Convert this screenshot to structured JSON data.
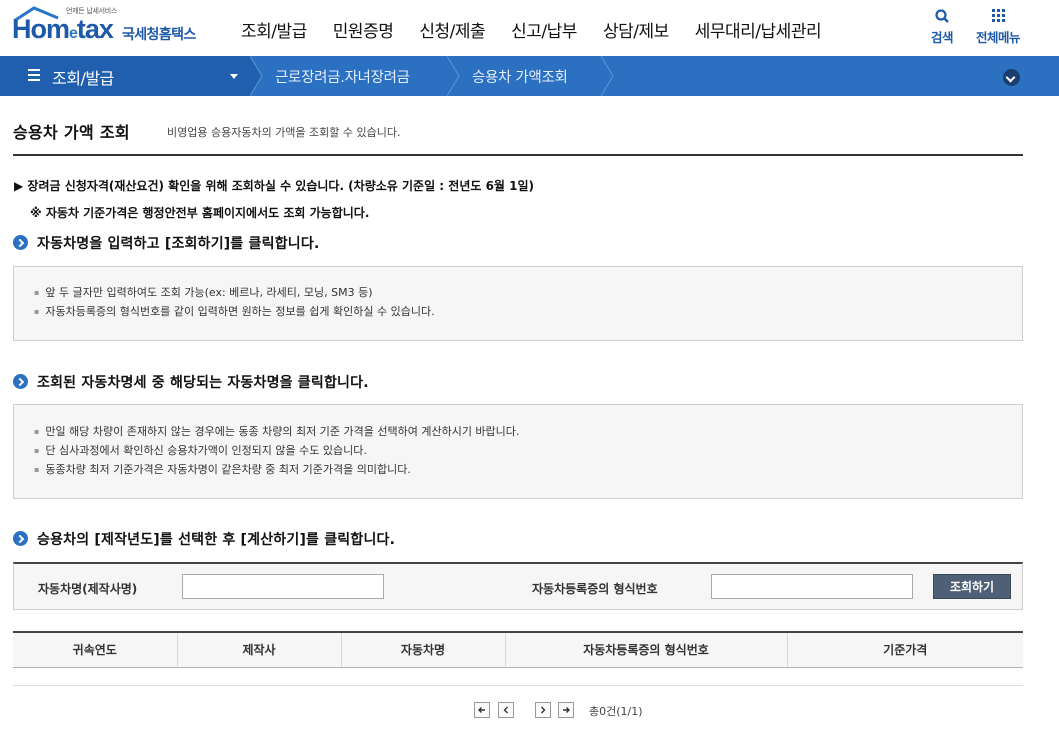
{
  "header": {
    "logo_small": "언제든 납세서비스",
    "logo_home": "Hom",
    "logo_e": "e",
    "logo_tax": "tax",
    "logo_kor": "국세청홈택스",
    "menu": [
      "조회/발급",
      "민원증명",
      "신청/제출",
      "신고/납부",
      "상담/제보",
      "세무대리/납세관리"
    ],
    "search_label": "검색",
    "all_menu_label": "전체메뉴"
  },
  "navbar": {
    "first": "조회/발급",
    "crumbs": [
      "근로장려금.자녀장려금",
      "승용차 가액조회"
    ]
  },
  "page": {
    "title": "승용차 가액 조회",
    "description": "비영업용 승용자동차의 가액을 조회할 수 있습니다.",
    "notice1": "▶ 장려금 신청자격(재산요건) 확인을 위해 조회하실 수 있습니다. (차량소유 기준일 : 전년도 6월 1일)",
    "notice2": "※ 자동차 기준가격은 행정안전부 홈페이지에서도 조회 가능합니다."
  },
  "steps": [
    {
      "title": "자동차명을 입력하고 [조회하기]를 클릭합니다.",
      "items": [
        "앞 두 글자만 입력하여도 조회 가능(ex: 베르나, 라세티, 모닝, SM3 등)",
        "자동차등록증의 형식번호를 같이 입력하면 원하는 정보를 쉽게 확인하실 수 있습니다."
      ]
    },
    {
      "title": "조회된 자동차명세 중 해당되는 자동차명을 클릭합니다.",
      "items": [
        "만일 해당 차량이 존재하지 않는 경우에는 동종 차량의 최저 기준 가격을 선택하여 계산하시기 바랍니다.",
        "단 심사과정에서 확인하신 승용차가액이 인정되지 않을 수도 있습니다.",
        "동종차량 최저 기준가격은 자동차명이 같은차량 중  최저 기준가격을 의미합니다."
      ]
    },
    {
      "title": "승용차의 [제작년도]를 선택한 후 [계산하기]를 클릭합니다."
    }
  ],
  "search": {
    "car_name_label": "자동차명(제작사명)",
    "car_name_value": "",
    "model_no_label": "자동차등록증의 형식번호",
    "model_no_value": "",
    "button_label": "조회하기"
  },
  "table": {
    "columns": [
      "귀속연도",
      "제작사",
      "자동차명",
      "자동차등록증의 형식번호",
      "기준가격"
    ],
    "rows": []
  },
  "paging": {
    "count_text": "총0건(1/1)"
  },
  "colors": {
    "brand_blue": "#2c70c2",
    "nav_dark": "#1f5fae",
    "button_gray": "#4f5f75"
  }
}
